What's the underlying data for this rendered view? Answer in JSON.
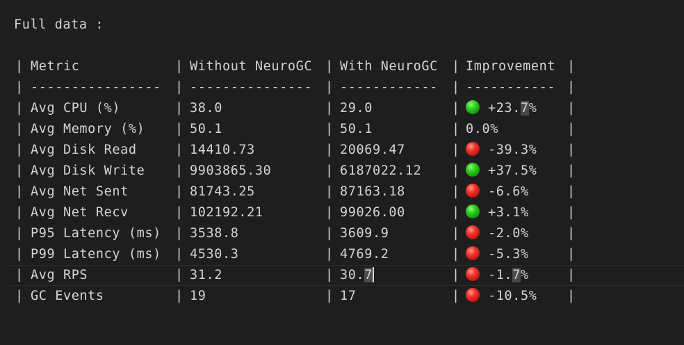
{
  "title": "Full data :",
  "header": {
    "metric": "Metric",
    "without": "Without NeuroGC",
    "with": "With NeuroGC",
    "improvement": "Improvement"
  },
  "divider": {
    "metric": "----------------",
    "without": "---------------",
    "with": "------------",
    "improvement": "-----------"
  },
  "rows": [
    {
      "metric": "Avg CPU (%)",
      "without": "38.0",
      "with": "29.0",
      "improvement": "+23.7%",
      "status": "green-circle-icon",
      "color": "#2fcc1f"
    },
    {
      "metric": "Avg Memory (%)",
      "without": "50.1",
      "with": "50.1",
      "improvement": "0.0%",
      "status": "none"
    },
    {
      "metric": "Avg Disk Read",
      "without": "14410.73",
      "with": "20069.47",
      "improvement": "-39.3%",
      "status": "red-circle-icon",
      "color": "#f0322a"
    },
    {
      "metric": "Avg Disk Write",
      "without": "9903865.30",
      "with": "6187022.12",
      "improvement": "+37.5%",
      "status": "green-circle-icon",
      "color": "#2fcc1f"
    },
    {
      "metric": "Avg Net Sent",
      "without": "81743.25",
      "with": "87163.18",
      "improvement": "-6.6%",
      "status": "red-circle-icon",
      "color": "#f0322a"
    },
    {
      "metric": "Avg Net Recv",
      "without": "102192.21",
      "with": "99026.00",
      "improvement": "+3.1%",
      "status": "green-circle-icon",
      "color": "#2fcc1f"
    },
    {
      "metric": "P95 Latency (ms)",
      "without": "3538.8",
      "with": "3609.9",
      "improvement": "-2.0%",
      "status": "red-circle-icon",
      "color": "#f0322a"
    },
    {
      "metric": "P99 Latency (ms)",
      "without": "4530.3",
      "with": "4769.2",
      "improvement": "-5.3%",
      "status": "red-circle-icon",
      "color": "#f0322a"
    },
    {
      "metric": "Avg RPS",
      "without": "31.2",
      "with": "30.7",
      "improvement": "-1.7%",
      "status": "red-circle-icon",
      "color": "#f0322a"
    },
    {
      "metric": "GC Events",
      "without": "19",
      "with": "17",
      "improvement": "-10.5%",
      "status": "red-circle-icon",
      "color": "#f0322a"
    }
  ],
  "colors": {
    "background": "#1e1e1e",
    "text": "#d4d4d4",
    "current_line_border": "#2c2c2c",
    "selection": "#4a4a4a"
  }
}
